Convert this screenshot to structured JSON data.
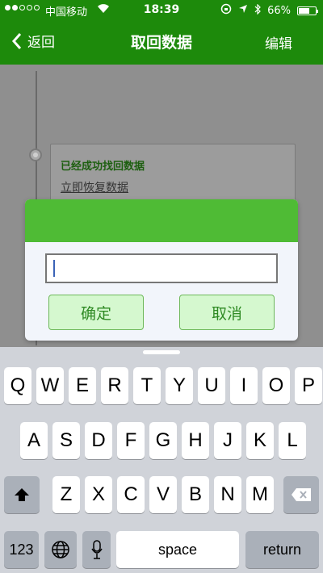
{
  "status_bar": {
    "carrier": "中国移动",
    "time": "18:39",
    "battery_percent": "66%",
    "battery_level": 0.66,
    "icons": [
      "signal-dots",
      "wifi-icon",
      "orientation-lock-icon",
      "location-icon",
      "bluetooth-icon",
      "battery-icon"
    ]
  },
  "nav": {
    "back_label": "返回",
    "title": "取回数据",
    "edit_label": "编辑"
  },
  "card": {
    "found_text": "已经成功找回数据",
    "restore_link": "立即恢复数据"
  },
  "dialog": {
    "input_value": "",
    "confirm_label": "确定",
    "cancel_label": "取消",
    "header_color": "#4fbb35"
  },
  "keyboard": {
    "row1": [
      "Q",
      "W",
      "E",
      "R",
      "T",
      "Y",
      "U",
      "I",
      "O",
      "P"
    ],
    "row2": [
      "A",
      "S",
      "D",
      "F",
      "G",
      "H",
      "J",
      "K",
      "L"
    ],
    "row3": [
      "Z",
      "X",
      "C",
      "V",
      "B",
      "N",
      "M"
    ],
    "numbers_label": "123",
    "space_label": "space",
    "return_label": "return"
  },
  "colors": {
    "nav_green": "#1d8a0b",
    "button_green": "#d5f8cf"
  }
}
